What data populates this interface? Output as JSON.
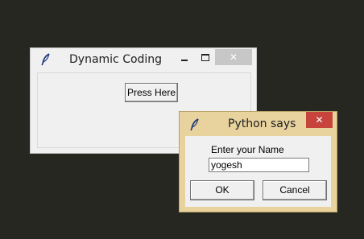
{
  "main_window": {
    "title": "Dynamic Coding",
    "icon": "feather-icon",
    "controls": {
      "minimize_icon": "minimize-icon",
      "maximize_icon": "maximize-icon",
      "close_label": "✕"
    },
    "button_label": "Press Here"
  },
  "dialog": {
    "title": "Python says",
    "icon": "feather-icon",
    "close_label": "✕",
    "prompt": "Enter your Name",
    "input_value": "yogesh",
    "ok_label": "OK",
    "cancel_label": "Cancel"
  },
  "colors": {
    "desktop": "#272722",
    "dialog_frame": "#e8d39e",
    "dialog_close": "#c7443c",
    "main_close_inactive": "#c7c7c7"
  }
}
